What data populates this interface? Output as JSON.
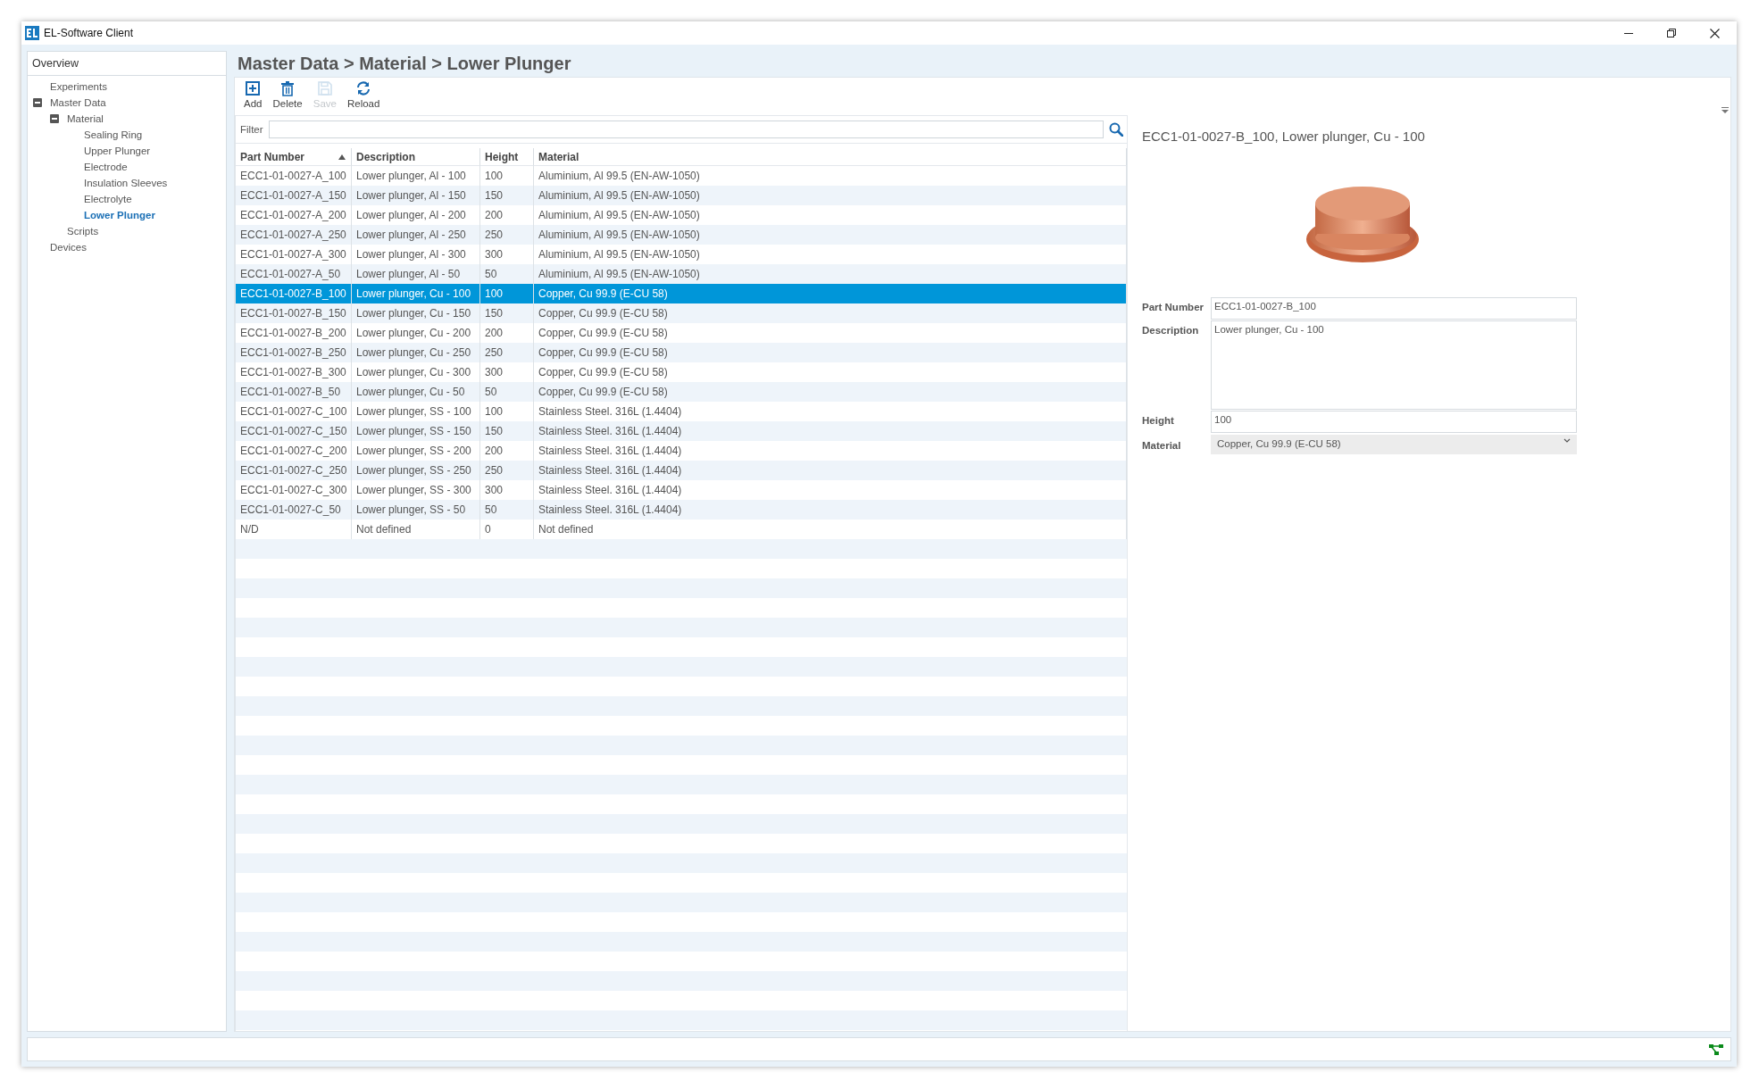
{
  "window": {
    "title": "EL-Software Client"
  },
  "sidebar": {
    "header": "Overview",
    "tree": [
      {
        "label": "Experiments",
        "selected": false
      },
      {
        "label": "Master Data",
        "selected": false,
        "expanded": true,
        "children": [
          {
            "label": "Material",
            "selected": false,
            "expanded": true,
            "children": [
              {
                "label": "Sealing Ring",
                "selected": false
              },
              {
                "label": "Upper Plunger",
                "selected": false
              },
              {
                "label": "Electrode",
                "selected": false
              },
              {
                "label": "Insulation Sleeves",
                "selected": false
              },
              {
                "label": "Electrolyte",
                "selected": false
              },
              {
                "label": "Lower Plunger",
                "selected": true
              }
            ]
          },
          {
            "label": "Scripts",
            "selected": false
          }
        ]
      },
      {
        "label": "Devices",
        "selected": false
      }
    ]
  },
  "page_title": "Master Data > Material > Lower Plunger",
  "toolbar": {
    "buttons": [
      {
        "label": "Add",
        "kind": "add",
        "disabled": false
      },
      {
        "label": "Delete",
        "kind": "delete",
        "disabled": false
      },
      {
        "label": "Save",
        "kind": "save",
        "disabled": true
      },
      {
        "label": "Reload",
        "kind": "reload",
        "disabled": false
      }
    ]
  },
  "filter": {
    "label": "Filter"
  },
  "table": {
    "columns": [
      {
        "label": "Part Number",
        "sorted": true
      },
      {
        "label": "Description",
        "sorted": false
      },
      {
        "label": "Height",
        "sorted": false
      },
      {
        "label": "Material",
        "sorted": false
      }
    ],
    "rows": [
      {
        "cells": [
          "ECC1-01-0027-A_100",
          "Lower plunger, Al - 100",
          "100",
          "Aluminium, Al 99.5 (EN-AW-1050)"
        ],
        "selected": false
      },
      {
        "cells": [
          "ECC1-01-0027-A_150",
          "Lower plunger, Al - 150",
          "150",
          "Aluminium, Al 99.5 (EN-AW-1050)"
        ],
        "selected": false
      },
      {
        "cells": [
          "ECC1-01-0027-A_200",
          "Lower plunger, Al - 200",
          "200",
          "Aluminium, Al 99.5 (EN-AW-1050)"
        ],
        "selected": false
      },
      {
        "cells": [
          "ECC1-01-0027-A_250",
          "Lower plunger, Al - 250",
          "250",
          "Aluminium, Al 99.5 (EN-AW-1050)"
        ],
        "selected": false
      },
      {
        "cells": [
          "ECC1-01-0027-A_300",
          "Lower plunger, Al - 300",
          "300",
          "Aluminium, Al 99.5 (EN-AW-1050)"
        ],
        "selected": false
      },
      {
        "cells": [
          "ECC1-01-0027-A_50",
          "Lower plunger, Al - 50",
          "50",
          "Aluminium, Al 99.5 (EN-AW-1050)"
        ],
        "selected": false
      },
      {
        "cells": [
          "ECC1-01-0027-B_100",
          "Lower plunger, Cu - 100",
          "100",
          "Copper, Cu 99.9 (E-CU 58)"
        ],
        "selected": true
      },
      {
        "cells": [
          "ECC1-01-0027-B_150",
          "Lower plunger, Cu - 150",
          "150",
          "Copper, Cu 99.9 (E-CU 58)"
        ],
        "selected": false
      },
      {
        "cells": [
          "ECC1-01-0027-B_200",
          "Lower plunger, Cu - 200",
          "200",
          "Copper, Cu 99.9 (E-CU 58)"
        ],
        "selected": false
      },
      {
        "cells": [
          "ECC1-01-0027-B_250",
          "Lower plunger, Cu - 250",
          "250",
          "Copper, Cu 99.9 (E-CU 58)"
        ],
        "selected": false
      },
      {
        "cells": [
          "ECC1-01-0027-B_300",
          "Lower plunger, Cu - 300",
          "300",
          "Copper, Cu 99.9 (E-CU 58)"
        ],
        "selected": false
      },
      {
        "cells": [
          "ECC1-01-0027-B_50",
          "Lower plunger, Cu - 50",
          "50",
          "Copper, Cu 99.9 (E-CU 58)"
        ],
        "selected": false
      },
      {
        "cells": [
          "ECC1-01-0027-C_100",
          "Lower plunger, SS - 100",
          "100",
          "Stainless Steel. 316L (1.4404)"
        ],
        "selected": false
      },
      {
        "cells": [
          "ECC1-01-0027-C_150",
          "Lower plunger, SS - 150",
          "150",
          "Stainless Steel. 316L (1.4404)"
        ],
        "selected": false
      },
      {
        "cells": [
          "ECC1-01-0027-C_200",
          "Lower plunger, SS - 200",
          "200",
          "Stainless Steel. 316L (1.4404)"
        ],
        "selected": false
      },
      {
        "cells": [
          "ECC1-01-0027-C_250",
          "Lower plunger, SS - 250",
          "250",
          "Stainless Steel. 316L (1.4404)"
        ],
        "selected": false
      },
      {
        "cells": [
          "ECC1-01-0027-C_300",
          "Lower plunger, SS - 300",
          "300",
          "Stainless Steel. 316L (1.4404)"
        ],
        "selected": false
      },
      {
        "cells": [
          "ECC1-01-0027-C_50",
          "Lower plunger, SS - 50",
          "50",
          "Stainless Steel. 316L (1.4404)"
        ],
        "selected": false
      },
      {
        "cells": [
          "N/D",
          "Not defined",
          "0",
          "Not defined"
        ],
        "selected": false
      }
    ]
  },
  "detail": {
    "title": "ECC1-01-0027-B_100, Lower plunger, Cu - 100",
    "fields": [
      {
        "label": "Part Number",
        "kind": "text",
        "value": "ECC1-01-0027-B_100"
      },
      {
        "label": "Description",
        "kind": "textarea",
        "value": "Lower plunger, Cu - 100"
      },
      {
        "label": "Height",
        "kind": "text",
        "value": "100"
      },
      {
        "label": "Material",
        "kind": "select",
        "value": "Copper, Cu 99.9 (E-CU 58)"
      }
    ]
  }
}
